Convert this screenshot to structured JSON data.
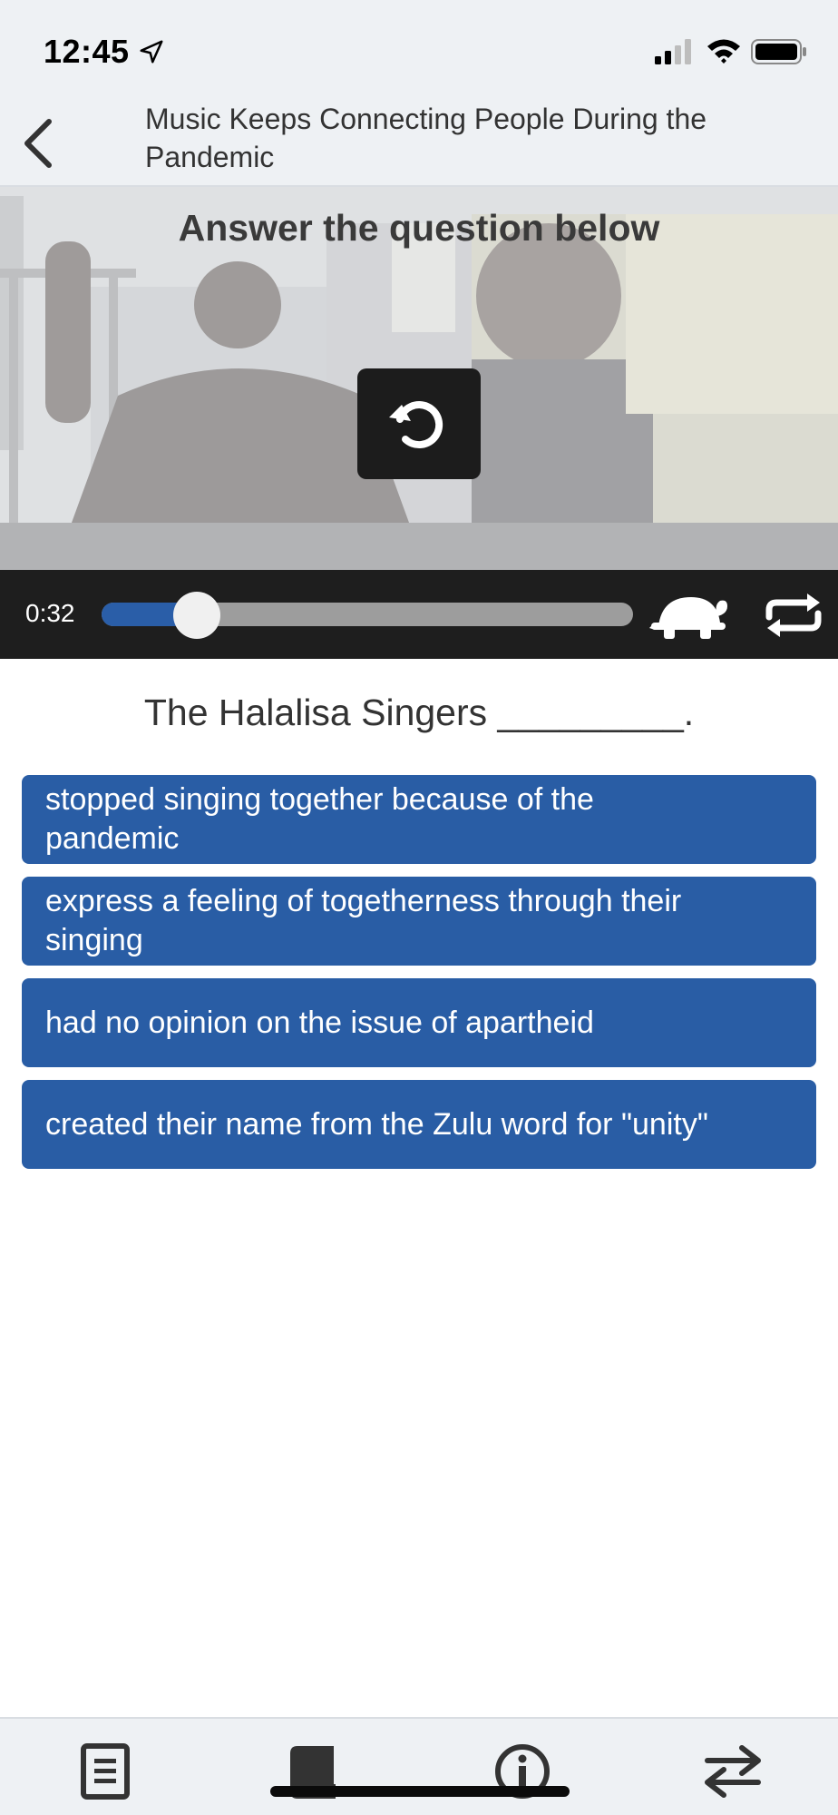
{
  "status_bar": {
    "time": "12:45"
  },
  "header": {
    "title": "Music Keeps Connecting People During the Pandemic"
  },
  "video": {
    "prompt": "Answer the question below",
    "current_time": "0:32",
    "progress_fraction": 0.18
  },
  "question": {
    "text": "The Halalisa Singers _________.",
    "options": [
      {
        "label": "stopped singing together because of the pandemic"
      },
      {
        "label": "express a feeling of togetherness through their singing"
      },
      {
        "label": "had no opinion on the issue of apartheid"
      },
      {
        "label": "created their name from the Zulu word for \"unity\""
      }
    ]
  },
  "tabbar": {
    "items": [
      "document-icon",
      "book-icon",
      "info-icon",
      "swap-icon"
    ]
  },
  "colors": {
    "accent": "#295da5",
    "player_bg": "#1e1e1e",
    "bar_bg": "#eef1f4"
  }
}
